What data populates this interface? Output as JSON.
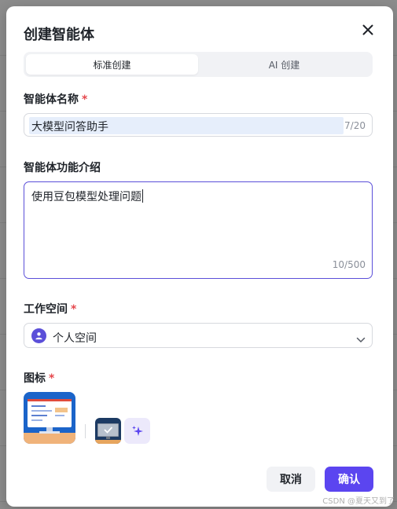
{
  "modal": {
    "title": "创建智能体"
  },
  "tabs": [
    {
      "label": "标准创建",
      "active": true
    },
    {
      "label": "AI 创建",
      "active": false
    }
  ],
  "name_field": {
    "label": "智能体名称",
    "required_mark": "*",
    "value": "大模型问答助手",
    "counter": "7/20"
  },
  "description_field": {
    "label": "智能体功能介绍",
    "value": "使用豆包模型处理问题",
    "counter": "10/500"
  },
  "workspace_field": {
    "label": "工作空间",
    "required_mark": "*",
    "value": "个人空间"
  },
  "icon_field": {
    "label": "图标",
    "required_mark": "*"
  },
  "buttons": {
    "cancel": "取消",
    "confirm": "确认"
  },
  "watermark": "CSDN @夏天又到了",
  "colors": {
    "accent": "#5b45f0",
    "required": "#e5484d",
    "focus_border": "#5b4fd9"
  },
  "icons": [
    "close-icon",
    "user-icon",
    "chevron-down-icon",
    "sparkle-icon"
  ]
}
